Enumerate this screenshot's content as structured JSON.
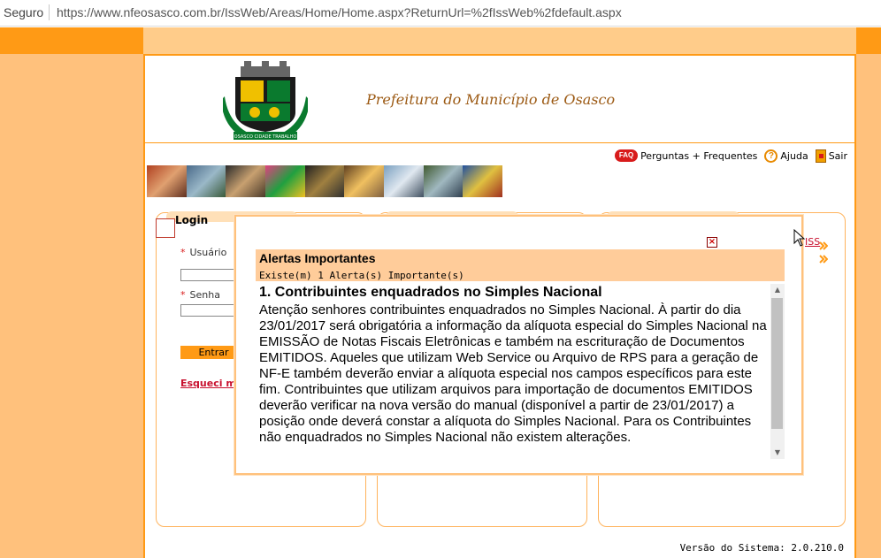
{
  "browser": {
    "secure_label": "Seguro",
    "url": "https://www.nfeosasco.com.br/IssWeb/Areas/Home/Home.aspx?ReturnUrl=%2fIssWeb%2fdefault.aspx"
  },
  "header": {
    "title": "Prefeitura do Município de Osasco",
    "crest_banner": "OSASCO CIDADE TRABALHO"
  },
  "nav": {
    "faq_icon_text": "FAQ",
    "faq_label": "Perguntas + Frequentes",
    "help_icon_text": "?",
    "help_label": "Ajuda",
    "exit_label": "Sair"
  },
  "login": {
    "title": "Login",
    "username_label": "Usuário",
    "password_label": "Senha",
    "enter_button": "Entrar",
    "forgot_link": "Esqueci minha senha",
    "required_mark": "*"
  },
  "side_link": "ISS",
  "alert": {
    "title": "Alertas Importantes",
    "subtitle": "Existe(m) 1 Alerta(s) Importante(s)",
    "item_title": "1. Contribuintes enquadrados no Simples Nacional",
    "item_body": "Atenção senhores contribuintes enquadrados no Simples Nacional. À partir do dia 23/01/2017 será obrigatória a informação da alíquota especial do Simples Nacional na EMISSÃO de Notas Fiscais Eletrônicas e também na escrituração de Documentos EMITIDOS. Aqueles que utilizam Web Service ou Arquivo de RPS para a geração de NF-E também deverão enviar a alíquota especial nos campos específicos para este fim. Contribuintes que utilizam arquivos para importação de documentos EMITIDOS deverão verificar na nova versão do manual (disponível a partir de 23/01/2017) a posição onde deverá constar a alíquota do Simples Nacional. Para os Contribuintes não enquadrados no Simples Nacional não existem alterações.",
    "close_glyph": "×",
    "scroll_up": "▲",
    "scroll_down": "▼"
  },
  "footer": {
    "version": "Versão do Sistema: 2.0.210.0"
  },
  "colors": {
    "orange": "#ff9a15",
    "light_orange": "#ffc17c",
    "header_text": "#9c5a14",
    "link_red": "#c8102e"
  },
  "icons": [
    "faq-icon",
    "help-icon",
    "exit-icon",
    "close-icon",
    "crest-icon",
    "arrow-icon"
  ]
}
